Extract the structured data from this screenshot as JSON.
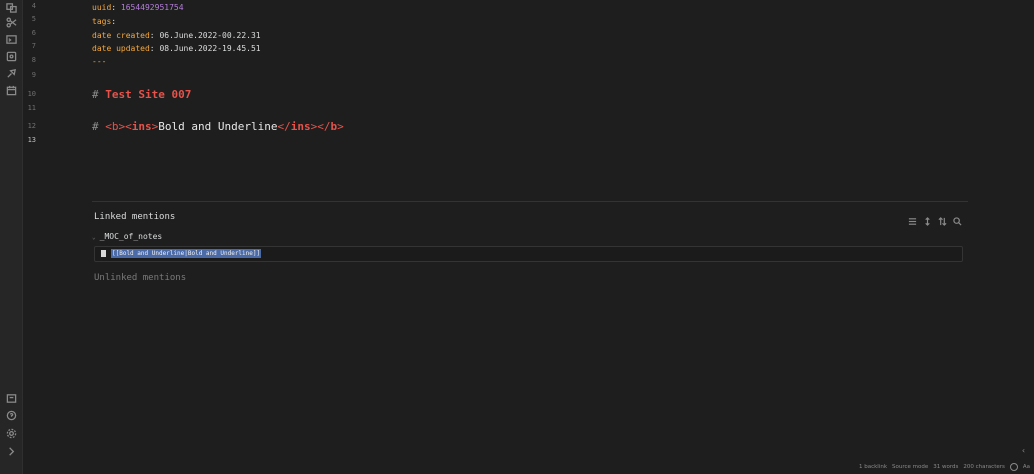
{
  "ribbon": {
    "top_icons": [
      "switcher-icon",
      "scissors-icon",
      "terminal-icon",
      "graph-icon",
      "publish-icon",
      "calendar-icon"
    ],
    "bottom_icons": [
      "vault-icon",
      "help-icon",
      "settings-icon",
      "expand-icon"
    ]
  },
  "gutter": {
    "lines": [
      "4",
      "5",
      "6",
      "7",
      "8",
      "9",
      "10",
      "11",
      "12",
      "13"
    ],
    "active": "13"
  },
  "frontmatter": {
    "uuid_key": "uuid",
    "uuid_val": "1654492951754",
    "tags_key": "tags",
    "created_key": "date created",
    "created_val": "06.June.2022-00.22.31",
    "updated_key": "date updated",
    "updated_val": "08.June.2022-19.45.51",
    "end_marker": "---"
  },
  "heading1": {
    "hash": "#",
    "text": "Test Site 007"
  },
  "heading2": {
    "hash": "#",
    "b_open": "<b>",
    "ins_open_lt": "<",
    "ins_open_tag": "ins",
    "ins_open_gt": ">",
    "text": "Bold and Underline",
    "ins_close_lt": "</",
    "ins_close_tag": "ins",
    "ins_close_gt": ">",
    "b_close_lt": "</",
    "b_close_tag": "b",
    "b_close_gt": ">"
  },
  "backlinks": {
    "title": "Linked mentions",
    "file_name": "_MOC_of_notes",
    "match_text": "[[Bold and Underline|Bold and Underline]]",
    "unlinked_title": "Unlinked mentions",
    "tools": [
      "list-icon",
      "expand-vertical-icon",
      "sort-icon",
      "search-icon"
    ]
  },
  "status_bar": {
    "backlinks": "1 backlink",
    "mode": "Source mode",
    "words": "31 words",
    "characters": "200 characters",
    "font": "Aa"
  }
}
